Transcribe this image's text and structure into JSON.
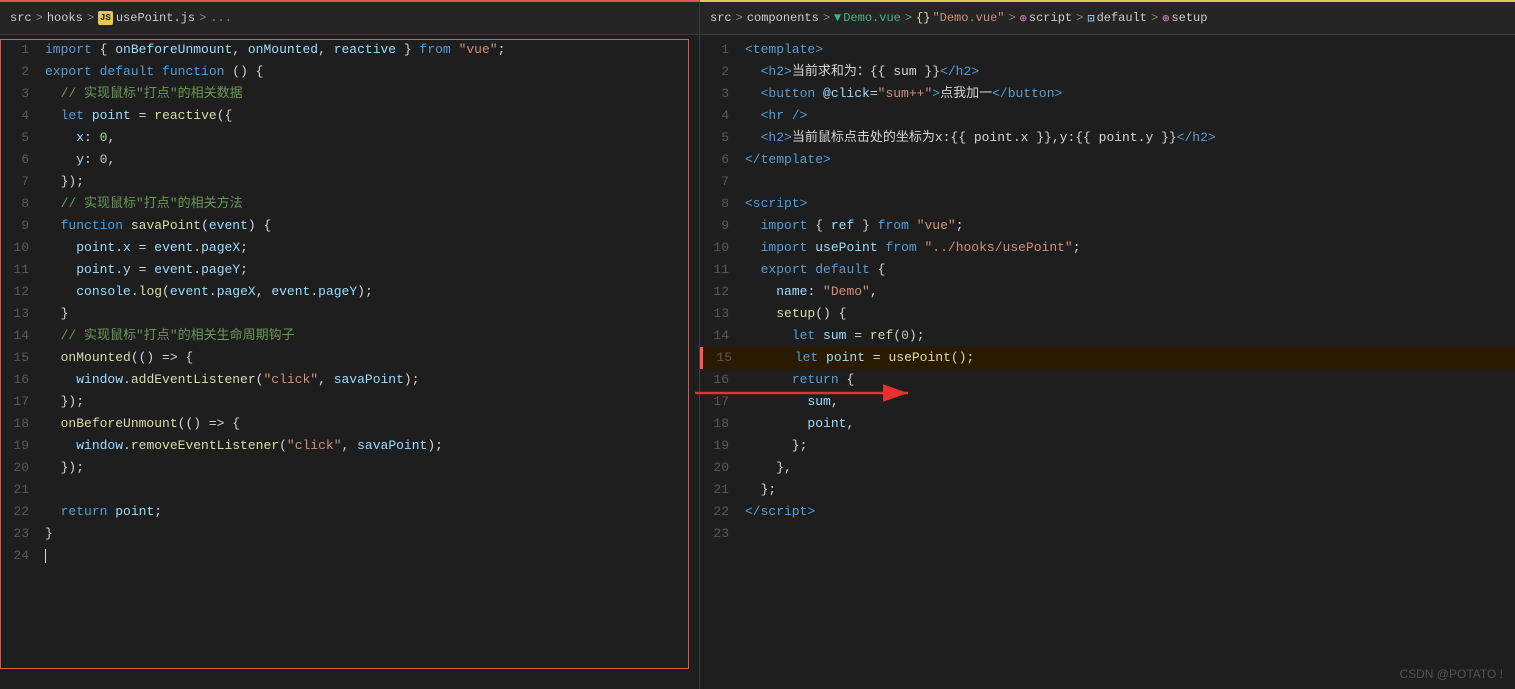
{
  "breadcrumb_left": {
    "src": "src",
    "sep1": ">",
    "hooks": "hooks",
    "sep2": ">",
    "icon": "JS",
    "file": "usePoint.js",
    "sep3": ">",
    "dots": "..."
  },
  "breadcrumb_right": {
    "src": "src",
    "sep1": ">",
    "components": "components",
    "sep2": ">",
    "file": "Demo.vue",
    "sep3": ">",
    "curly": "{}",
    "demo_vue": "\"Demo.vue\"",
    "sep4": ">",
    "script_icon": "⊕",
    "script": "script",
    "sep5": ">",
    "default_icon": "⊡",
    "default": "default",
    "sep6": ">",
    "setup_icon": "⊕",
    "setup": "setup"
  },
  "left_code": [
    {
      "num": "1",
      "content": "import_line"
    },
    {
      "num": "2",
      "content": "export_line"
    },
    {
      "num": "3",
      "content": "cmt_data"
    },
    {
      "num": "4",
      "content": "let_point"
    },
    {
      "num": "5",
      "content": "x_0"
    },
    {
      "num": "6",
      "content": "y_0"
    },
    {
      "num": "7",
      "content": "close_obj"
    },
    {
      "num": "8",
      "content": "cmt_method"
    },
    {
      "num": "9",
      "content": "fn_sava"
    },
    {
      "num": "10",
      "content": "point_x"
    },
    {
      "num": "11",
      "content": "point_y"
    },
    {
      "num": "12",
      "content": "console_log"
    },
    {
      "num": "13",
      "content": "close_brace"
    },
    {
      "num": "14",
      "content": "cmt_lifecycle"
    },
    {
      "num": "15",
      "content": "on_mounted"
    },
    {
      "num": "16",
      "content": "add_listener"
    },
    {
      "num": "17",
      "content": "close_mounted"
    },
    {
      "num": "18",
      "content": "on_before"
    },
    {
      "num": "19",
      "content": "remove_listener"
    },
    {
      "num": "20",
      "content": "close_before"
    },
    {
      "num": "21",
      "content": "empty"
    },
    {
      "num": "22",
      "content": "return_point"
    },
    {
      "num": "23",
      "content": "close_fn"
    },
    {
      "num": "24",
      "content": "cursor"
    }
  ],
  "right_code": [
    {
      "num": "1",
      "content": "r_template_open"
    },
    {
      "num": "2",
      "content": "r_h2_sum"
    },
    {
      "num": "3",
      "content": "r_button"
    },
    {
      "num": "4",
      "content": "r_hr"
    },
    {
      "num": "5",
      "content": "r_h2_point"
    },
    {
      "num": "6",
      "content": "r_template_close"
    },
    {
      "num": "7",
      "content": "r_empty"
    },
    {
      "num": "8",
      "content": "r_script_open"
    },
    {
      "num": "9",
      "content": "r_import_ref"
    },
    {
      "num": "10",
      "content": "r_import_usepoint"
    },
    {
      "num": "11",
      "content": "r_export"
    },
    {
      "num": "12",
      "content": "r_name"
    },
    {
      "num": "13",
      "content": "r_setup"
    },
    {
      "num": "14",
      "content": "r_let_sum"
    },
    {
      "num": "15",
      "content": "r_let_point_highlight"
    },
    {
      "num": "16",
      "content": "r_return"
    },
    {
      "num": "17",
      "content": "r_sum"
    },
    {
      "num": "18",
      "content": "r_point_comma"
    },
    {
      "num": "19",
      "content": "r_close_return"
    },
    {
      "num": "20",
      "content": "r_close_setup"
    },
    {
      "num": "21",
      "content": "r_close_export"
    },
    {
      "num": "22",
      "content": "r_script_close"
    },
    {
      "num": "23",
      "content": "r_empty2"
    }
  ],
  "watermark": "CSDN @POTATO !"
}
